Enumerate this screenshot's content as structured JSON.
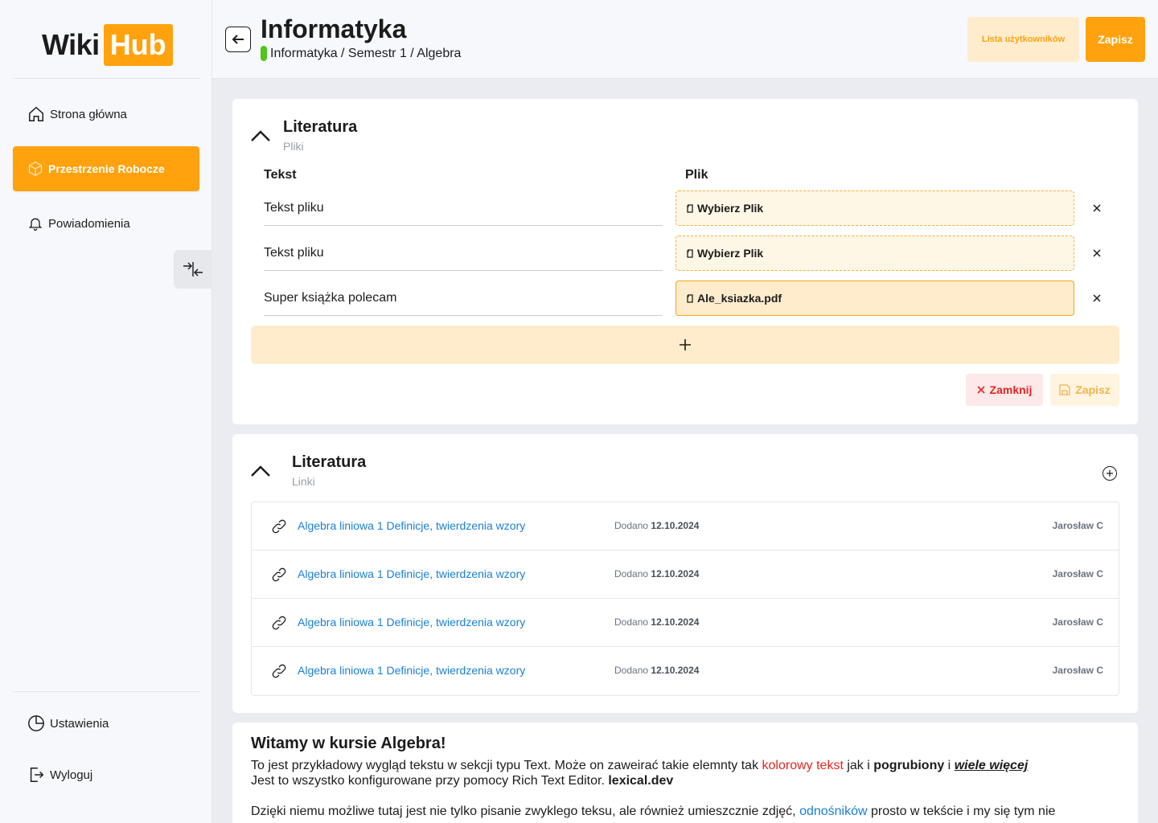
{
  "sidebar": {
    "logo_wiki": "Wiki",
    "logo_hub": "Hub",
    "items": [
      {
        "label": "Strona główna",
        "icon": "home-icon"
      },
      {
        "label": "Przestrzenie Robocze",
        "icon": "cube-icon",
        "active": true
      },
      {
        "label": "Powiadomienia",
        "icon": "bell-icon"
      }
    ],
    "bottom_items": [
      {
        "label": "Ustawienia",
        "icon": "pie-chart-icon"
      },
      {
        "label": "Wyloguj",
        "icon": "logout-icon"
      }
    ]
  },
  "header": {
    "title": "Informatyka",
    "breadcrumb": "Informatyka / Semestr 1 / Algebra",
    "users_button": "Lista użytkowników",
    "save_button": "Zapisz"
  },
  "files_section": {
    "title": "Literatura",
    "subtitle": "Pliki",
    "col_text": "Tekst",
    "col_file": "Plik",
    "rows": [
      {
        "text": "Tekst pliku",
        "file": "Wybierz Plik",
        "filled": false
      },
      {
        "text": "Tekst pliku",
        "file": "Wybierz Plik",
        "filled": false
      },
      {
        "text": "Super książka polecam",
        "file": "Ale_ksiazka.pdf",
        "filled": true
      }
    ],
    "add_symbol": "+",
    "close_button": "Zamknij",
    "save_button": "Zapisz"
  },
  "links_section": {
    "title": "Literatura",
    "subtitle": "Linki",
    "rows": [
      {
        "title": "Algebra liniowa 1 Definicje, twierdzenia wzory",
        "added_label": "Dodano",
        "date": "12.10.2024",
        "author": "Jarosław C"
      },
      {
        "title": "Algebra liniowa 1 Definicje, twierdzenia wzory",
        "added_label": "Dodano",
        "date": "12.10.2024",
        "author": "Jarosław C"
      },
      {
        "title": "Algebra liniowa 1 Definicje, twierdzenia wzory",
        "added_label": "Dodano",
        "date": "12.10.2024",
        "author": "Jarosław C"
      },
      {
        "title": "Algebra liniowa 1 Definicje, twierdzenia wzory",
        "added_label": "Dodano",
        "date": "12.10.2024",
        "author": "Jarosław C"
      }
    ]
  },
  "text_section": {
    "heading": "Witamy w kursie Algebra!",
    "p1_a": "To jest przykładowy wygląd tekstu w sekcji typu Text. Może on zaweirać takie elemnty tak ",
    "p1_red": "kolorowy tekst",
    "p1_b": " jak i ",
    "p1_bold": "pogrubiony",
    "p1_c": " i ",
    "p1_em": "wiele więcej",
    "p2_a": "Jest to wszystko konfigurowane przy pomocy Rich Text Editor. ",
    "p2_bold": "lexical.dev",
    "p3_a": "Dzięki niemu możliwe tutaj jest nie tylko pisanie zwyklego teksu, ale również umieszcznie zdjęć, ",
    "p3_link": "odnośników",
    "p3_b": " prosto w tekście i my się tym nie"
  },
  "colors": {
    "accent": "#ffa20e",
    "accent_light": "#ffeccc",
    "danger": "#e2261f",
    "link": "#1a7fd4",
    "status_green": "#52c41a"
  }
}
